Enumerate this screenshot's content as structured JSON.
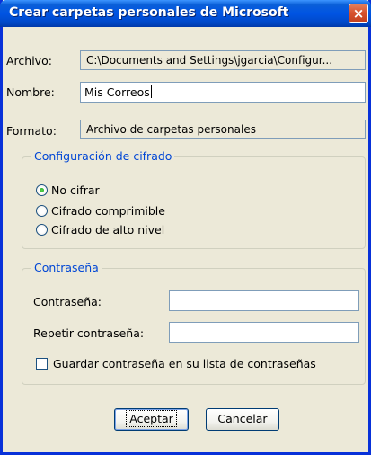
{
  "window": {
    "title": "Crear carpetas personales de Microsoft",
    "close_symbol": "×"
  },
  "fields": {
    "archivo_label": "Archivo:",
    "archivo_value": "C:\\Documents and Settings\\jgarcia\\Configur...",
    "nombre_label": "Nombre:",
    "nombre_value": "Mis Correos",
    "formato_label": "Formato:",
    "formato_value": "Archivo de carpetas personales"
  },
  "encryption": {
    "legend": "Configuración de cifrado",
    "options": [
      {
        "label": "No cifrar",
        "selected": true
      },
      {
        "label": "Cifrado comprimible",
        "selected": false
      },
      {
        "label": "Cifrado de alto nivel",
        "selected": false
      }
    ]
  },
  "password": {
    "legend": "Contraseña",
    "password_label": "Contraseña:",
    "password_value": "",
    "repeat_label": "Repetir contraseña:",
    "repeat_value": "",
    "save_checkbox_label": "Guardar contraseña en su lista de contraseñas",
    "save_checked": false
  },
  "buttons": {
    "ok": "Aceptar",
    "cancel": "Cancelar"
  },
  "icons": {
    "close": "close-icon"
  }
}
